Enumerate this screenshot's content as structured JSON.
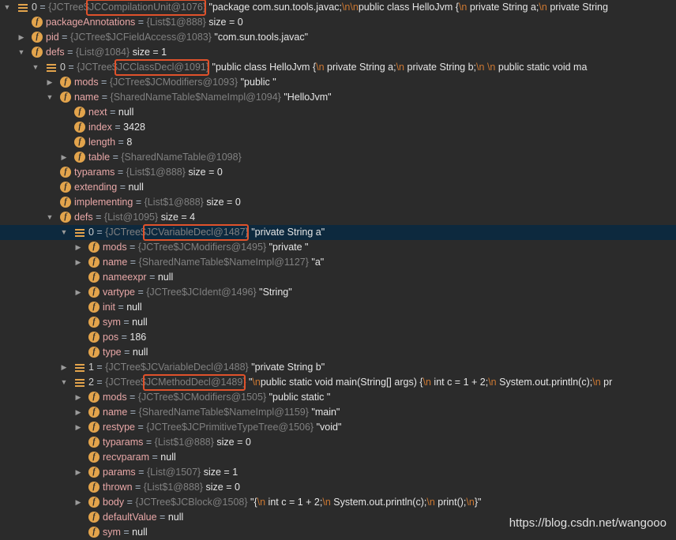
{
  "rows": [
    {
      "indent": 0,
      "arrow": "open",
      "icon": "array",
      "name": "0",
      "type": "{JCTree$JCCompilationUnit@1076}",
      "value": "\"package com.sun.tools.javac;\\n\\npublic class HelloJvm {\\n    private String a;\\n    private String",
      "highlight": true
    },
    {
      "indent": 1,
      "arrow": "none",
      "icon": "field",
      "name": "packageAnnotations",
      "type": "{List$1@888}",
      "value": "size = 0"
    },
    {
      "indent": 1,
      "arrow": "closed",
      "icon": "field",
      "name": "pid",
      "type": "{JCTree$JCFieldAccess@1083}",
      "value": "\"com.sun.tools.javac\""
    },
    {
      "indent": 1,
      "arrow": "open",
      "icon": "field",
      "name": "defs",
      "type": "{List@1084}",
      "value": "size = 1"
    },
    {
      "indent": 2,
      "arrow": "open",
      "icon": "array",
      "name": "0",
      "type": "{JCTree$JCClassDecl@1091}",
      "value": "\"public class HelloJvm {\\n    private String a;\\n    private String b;\\n    \\n    public static void ma",
      "highlight": true
    },
    {
      "indent": 3,
      "arrow": "closed",
      "icon": "field",
      "name": "mods",
      "type": "{JCTree$JCModifiers@1093}",
      "value": "\"public \""
    },
    {
      "indent": 3,
      "arrow": "open",
      "icon": "field",
      "name": "name",
      "type": "{SharedNameTable$NameImpl@1094}",
      "value": "\"HelloJvm\""
    },
    {
      "indent": 4,
      "arrow": "none",
      "icon": "field",
      "name": "next",
      "type": "",
      "value": "null"
    },
    {
      "indent": 4,
      "arrow": "none",
      "icon": "field",
      "name": "index",
      "type": "",
      "value": "3428"
    },
    {
      "indent": 4,
      "arrow": "none",
      "icon": "field",
      "name": "length",
      "type": "",
      "value": "8"
    },
    {
      "indent": 4,
      "arrow": "closed",
      "icon": "field",
      "name": "table",
      "type": "{SharedNameTable@1098}",
      "value": ""
    },
    {
      "indent": 3,
      "arrow": "none",
      "icon": "field",
      "name": "typarams",
      "type": "{List$1@888}",
      "value": "size = 0"
    },
    {
      "indent": 3,
      "arrow": "none",
      "icon": "field",
      "name": "extending",
      "type": "",
      "value": "null"
    },
    {
      "indent": 3,
      "arrow": "none",
      "icon": "field",
      "name": "implementing",
      "type": "{List$1@888}",
      "value": "size = 0"
    },
    {
      "indent": 3,
      "arrow": "open",
      "icon": "field",
      "name": "defs",
      "type": "{List@1095}",
      "value": "size = 4"
    },
    {
      "indent": 4,
      "arrow": "open",
      "icon": "array",
      "name": "0",
      "type": "{JCTree$JCVariableDecl@1487}",
      "value": "\"private String a\"",
      "highlight": true,
      "selected": true
    },
    {
      "indent": 5,
      "arrow": "closed",
      "icon": "field",
      "name": "mods",
      "type": "{JCTree$JCModifiers@1495}",
      "value": "\"private \""
    },
    {
      "indent": 5,
      "arrow": "closed",
      "icon": "field",
      "name": "name",
      "type": "{SharedNameTable$NameImpl@1127}",
      "value": "\"a\""
    },
    {
      "indent": 5,
      "arrow": "none",
      "icon": "field",
      "name": "nameexpr",
      "type": "",
      "value": "null"
    },
    {
      "indent": 5,
      "arrow": "closed",
      "icon": "field",
      "name": "vartype",
      "type": "{JCTree$JCIdent@1496}",
      "value": "\"String\""
    },
    {
      "indent": 5,
      "arrow": "none",
      "icon": "field",
      "name": "init",
      "type": "",
      "value": "null"
    },
    {
      "indent": 5,
      "arrow": "none",
      "icon": "field",
      "name": "sym",
      "type": "",
      "value": "null"
    },
    {
      "indent": 5,
      "arrow": "none",
      "icon": "field",
      "name": "pos",
      "type": "",
      "value": "186"
    },
    {
      "indent": 5,
      "arrow": "none",
      "icon": "field",
      "name": "type",
      "type": "",
      "value": "null"
    },
    {
      "indent": 4,
      "arrow": "closed",
      "icon": "array",
      "name": "1",
      "type": "{JCTree$JCVariableDecl@1488}",
      "value": "\"private String b\""
    },
    {
      "indent": 4,
      "arrow": "open",
      "icon": "array",
      "name": "2",
      "type": "{JCTree$JCMethodDecl@1489}",
      "value": "\"\\npublic static void main(String[] args) {\\n    int c = 1 + 2;\\n    System.out.println(c);\\n    pr",
      "highlight": true
    },
    {
      "indent": 5,
      "arrow": "closed",
      "icon": "field",
      "name": "mods",
      "type": "{JCTree$JCModifiers@1505}",
      "value": "\"public static \""
    },
    {
      "indent": 5,
      "arrow": "closed",
      "icon": "field",
      "name": "name",
      "type": "{SharedNameTable$NameImpl@1159}",
      "value": "\"main\""
    },
    {
      "indent": 5,
      "arrow": "closed",
      "icon": "field",
      "name": "restype",
      "type": "{JCTree$JCPrimitiveTypeTree@1506}",
      "value": "\"void\""
    },
    {
      "indent": 5,
      "arrow": "none",
      "icon": "field",
      "name": "typarams",
      "type": "{List$1@888}",
      "value": "size = 0"
    },
    {
      "indent": 5,
      "arrow": "none",
      "icon": "field",
      "name": "recvparam",
      "type": "",
      "value": "null"
    },
    {
      "indent": 5,
      "arrow": "closed",
      "icon": "field",
      "name": "params",
      "type": "{List@1507}",
      "value": "size = 1"
    },
    {
      "indent": 5,
      "arrow": "none",
      "icon": "field",
      "name": "thrown",
      "type": "{List$1@888}",
      "value": "size = 0"
    },
    {
      "indent": 5,
      "arrow": "closed",
      "icon": "field",
      "name": "body",
      "type": "{JCTree$JCBlock@1508}",
      "value": "\"{\\n    int c = 1 + 2;\\n    System.out.println(c);\\n    print();\\n}\""
    },
    {
      "indent": 5,
      "arrow": "none",
      "icon": "field",
      "name": "defaultValue",
      "type": "",
      "value": "null"
    },
    {
      "indent": 5,
      "arrow": "none",
      "icon": "field",
      "name": "sym",
      "type": "",
      "value": "null"
    }
  ],
  "watermark": "https://blog.csdn.net/wangooo",
  "colors": {
    "background": "#2b2b2b",
    "selection": "#0d293e",
    "field_icon": "#e3a44c",
    "highlight_box": "#e0522b",
    "name": "#e8a7a7",
    "escape": "#cc7832"
  }
}
